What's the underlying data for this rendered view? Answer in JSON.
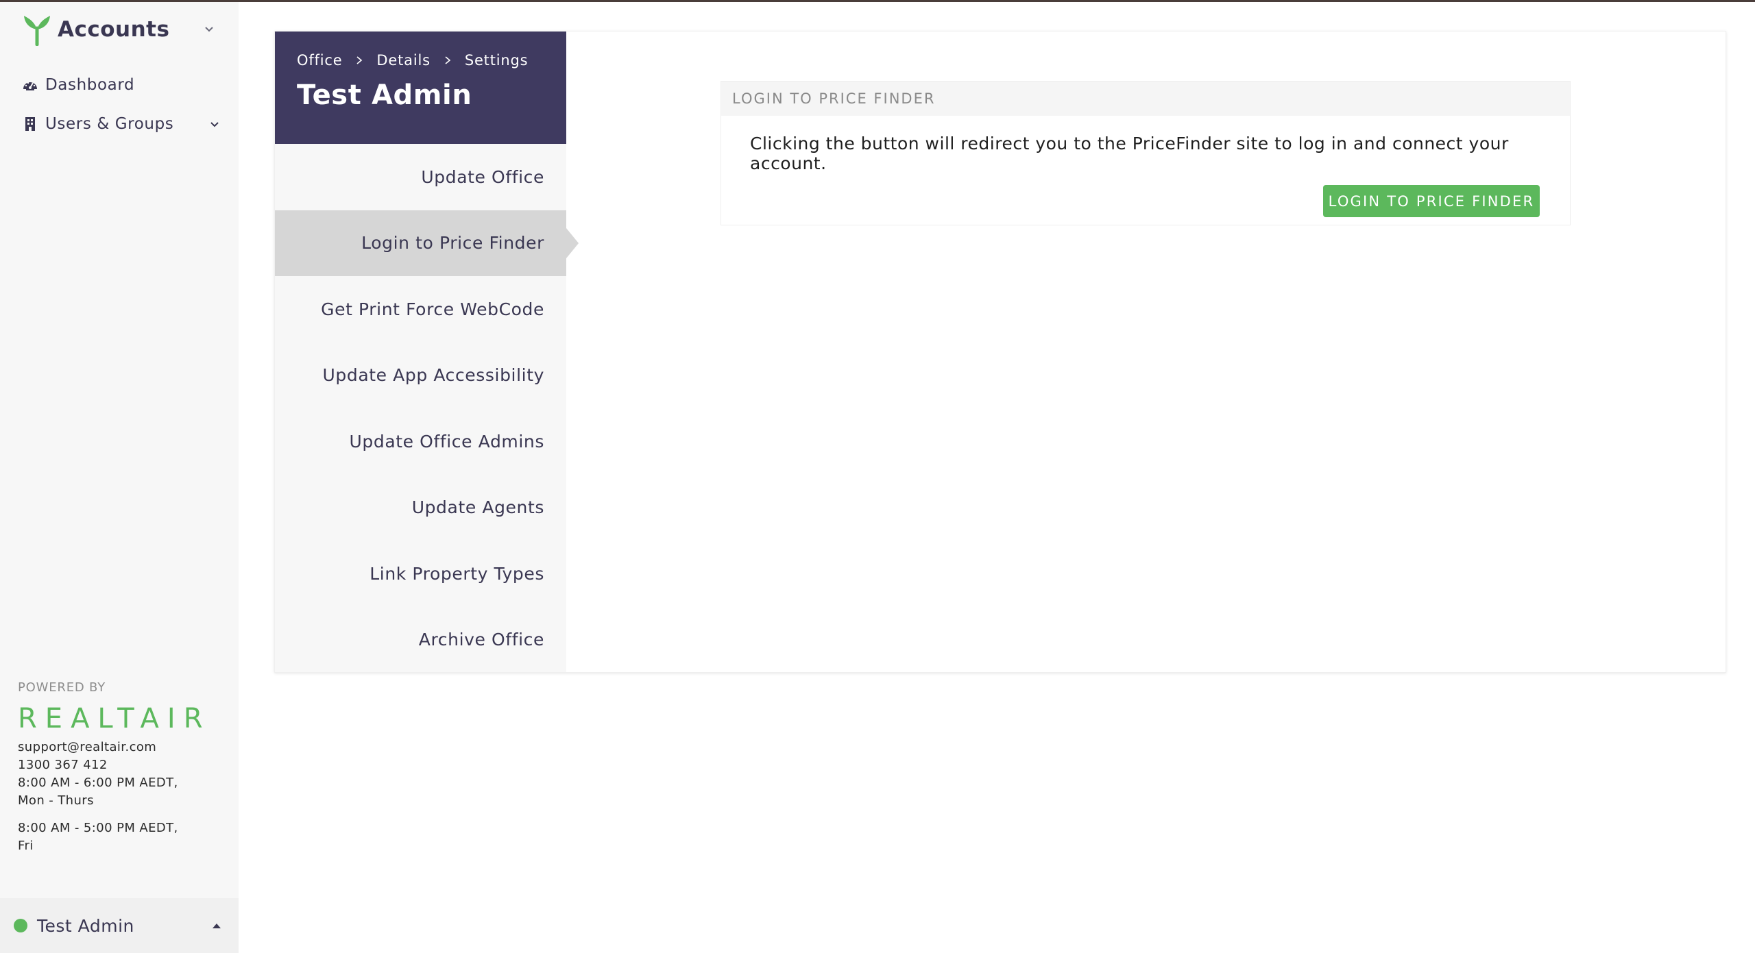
{
  "app": {
    "title": "Accounts",
    "nav": [
      {
        "label": "Dashboard",
        "icon": "dashboard-icon"
      },
      {
        "label": "Users & Groups",
        "icon": "building-icon"
      }
    ],
    "footer": {
      "powered_by": "POWERED BY",
      "brand": "REALTAIR",
      "email": "support@realtair.com",
      "phone": "1300 367 412",
      "hours_weekday_time": "8:00 AM - 6:00 PM AEDT,",
      "hours_weekday_days": "Mon - Thurs",
      "hours_friday_time": "8:00 AM - 5:00 PM AEDT,",
      "hours_friday_days": "Fri"
    },
    "user": {
      "name": "Test Admin",
      "status_color": "#5cb85c"
    }
  },
  "settings": {
    "breadcrumb": [
      "Office",
      "Details",
      "Settings"
    ],
    "title": "Test Admin",
    "menu": [
      "Update Office",
      "Login to Price Finder",
      "Get Print Force WebCode",
      "Update App Accessibility",
      "Update Office Admins",
      "Update Agents",
      "Link Property Types",
      "Archive Office"
    ],
    "active_index": 1
  },
  "panel": {
    "heading": "LOGIN TO PRICE FINDER",
    "text": "Clicking the button will redirect you to the PriceFinder site to log in and connect your account.",
    "button_label": "LOGIN TO PRICE FINDER"
  },
  "colors": {
    "accent_green": "#5cb85c",
    "header_purple": "#3f3a60",
    "active_menu": "#d6d6d6"
  }
}
